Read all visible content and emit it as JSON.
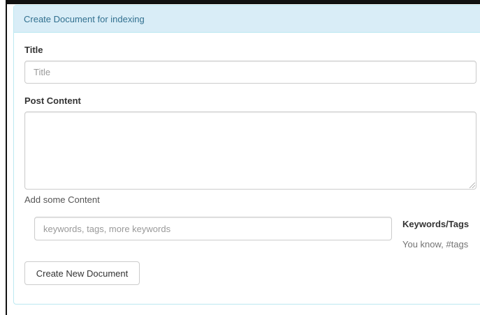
{
  "panel": {
    "heading": "Create Document for indexing"
  },
  "form": {
    "title_label": "Title",
    "title_placeholder": "Title",
    "title_value": "",
    "content_label": "Post Content",
    "content_value": "",
    "content_help": "Add some Content",
    "keywords_placeholder": "keywords, tags, more keywords",
    "keywords_value": "",
    "keywords_label": "Keywords/Tags",
    "keywords_help": "You know, #tags",
    "submit_label": "Create New Document"
  },
  "colors": {
    "heading_bg": "#d9edf7",
    "heading_text": "#31708f",
    "panel_border": "#bce8f1"
  }
}
